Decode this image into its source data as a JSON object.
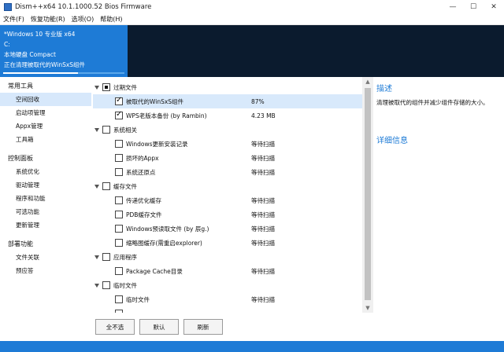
{
  "window": {
    "title": "Dism++x64 10.1.1000.52 Bios Firmware",
    "icon": "app-icon",
    "controls": [
      "—",
      "☐",
      "✕"
    ]
  },
  "menu": [
    "文件(F)",
    "恢复功能(R)",
    "选项(O)",
    "帮助(H)"
  ],
  "session": {
    "name": "*Windows 10 专业版 x64",
    "drive": "C:",
    "disk": "本地硬盘 Compact",
    "status": "正在清理被取代的WinSxS组件",
    "progress": 0.62
  },
  "sidebar": {
    "groups": [
      {
        "label": "常用工具",
        "items": [
          "空间回收",
          "启动项管理",
          "Appx管理",
          "工具箱"
        ]
      },
      {
        "label": "控制面板",
        "items": [
          "系统优化",
          "驱动管理",
          "程序和功能",
          "可选功能",
          "更新管理"
        ]
      },
      {
        "label": "部署功能",
        "items": [
          "文件关联",
          "预应答"
        ]
      }
    ],
    "selected": "空间回收"
  },
  "tree": {
    "rows": [
      {
        "level": 0,
        "label": "过期文件",
        "checked": "partial",
        "status": ""
      },
      {
        "level": 1,
        "label": "被取代的WinSxS组件",
        "checked": true,
        "status": "87%",
        "selected": true
      },
      {
        "level": 1,
        "label": "WPS老版本备份 (by Rambin)",
        "checked": true,
        "status": "4.23 MB"
      },
      {
        "level": 0,
        "label": "系统相关",
        "checked": false,
        "status": ""
      },
      {
        "level": 1,
        "label": "Windows更新安装记录",
        "checked": false,
        "status": "等待扫描"
      },
      {
        "level": 1,
        "label": "损坏的Appx",
        "checked": false,
        "status": "等待扫描"
      },
      {
        "level": 1,
        "label": "系统还原点",
        "checked": false,
        "status": "等待扫描"
      },
      {
        "level": 0,
        "label": "缓存文件",
        "checked": false,
        "status": ""
      },
      {
        "level": 1,
        "label": "传递优化缓存",
        "checked": false,
        "status": "等待扫描"
      },
      {
        "level": 1,
        "label": "PDB缓存文件",
        "checked": false,
        "status": "等待扫描"
      },
      {
        "level": 1,
        "label": "Windows预读取文件 (by 辰g.)",
        "checked": false,
        "status": "等待扫描"
      },
      {
        "level": 1,
        "label": "缩略图缓存(需重启explorer)",
        "checked": false,
        "status": "等待扫描"
      },
      {
        "level": 0,
        "label": "应用程序",
        "checked": false,
        "status": ""
      },
      {
        "level": 1,
        "label": "Package Cache目录",
        "checked": false,
        "status": "等待扫描"
      },
      {
        "level": 0,
        "label": "临时文件",
        "checked": false,
        "status": ""
      },
      {
        "level": 1,
        "label": "临时文件",
        "checked": false,
        "status": "等待扫描"
      },
      {
        "level": 1,
        "label": "",
        "checked": false,
        "status": ""
      }
    ]
  },
  "details": {
    "title": "描述",
    "description": "清理被取代的组件并减少组件存储的大小。",
    "title2": "详细信息"
  },
  "buttons": {
    "select_none": "全不选",
    "default": "默认",
    "refresh": "刷新"
  },
  "colors": {
    "accent": "#1e7bd6",
    "dark": "#0b1b2e",
    "selection": "#d8e9fb"
  }
}
